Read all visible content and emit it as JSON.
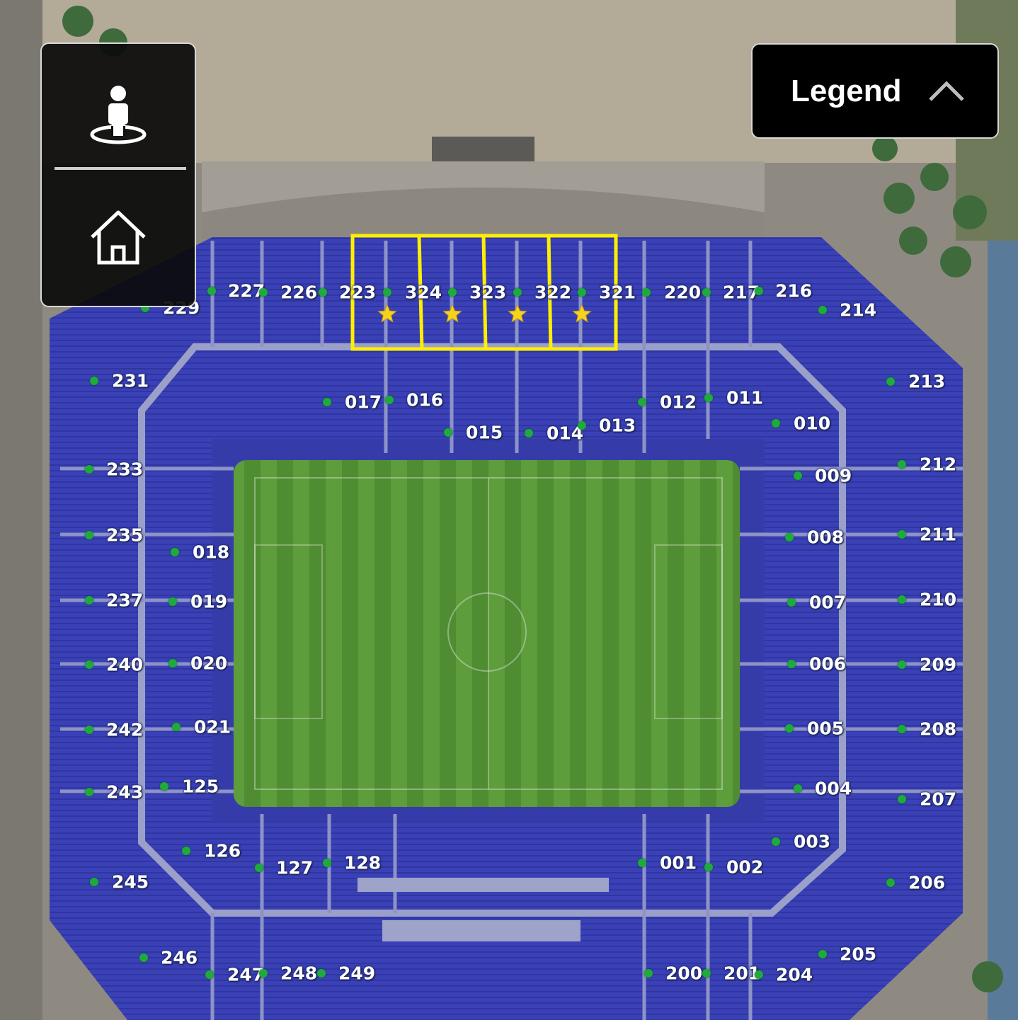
{
  "legend": {
    "label": "Legend",
    "icon": "chevron-up-icon"
  },
  "controls": {
    "view_icon": "person-pin-icon",
    "home_icon": "home-icon"
  },
  "colors": {
    "seating": "#3a40b5",
    "pitch": "#5a9a3a",
    "highlight": "#ffee00",
    "dot": "#1faa3d",
    "star": "#f7d21c"
  },
  "highlighted_sections": [
    "324",
    "323",
    "322",
    "321"
  ],
  "sections": {
    "s229": "229",
    "s227": "227",
    "s226": "226",
    "s223": "223",
    "s324": "324",
    "s323": "323",
    "s322": "322",
    "s321": "321",
    "s220": "220",
    "s217": "217",
    "s216": "216",
    "s214": "214",
    "s231": "231",
    "s017": "017",
    "s016": "016",
    "s015": "015",
    "s014": "014",
    "s013": "013",
    "s012": "012",
    "s011": "011",
    "s010": "010",
    "s213": "213",
    "s233": "233",
    "s009": "009",
    "s212": "212",
    "s235": "235",
    "s018": "018",
    "s008": "008",
    "s211": "211",
    "s237": "237",
    "s019": "019",
    "s007": "007",
    "s210": "210",
    "s240": "240",
    "s020": "020",
    "s006": "006",
    "s209": "209",
    "s242": "242",
    "s021": "021",
    "s005": "005",
    "s208": "208",
    "s243": "243",
    "s125": "125",
    "s004": "004",
    "s207": "207",
    "s126": "126",
    "s003": "003",
    "s245": "245",
    "s127": "127",
    "s128": "128",
    "s001": "001",
    "s002": "002",
    "s206": "206",
    "s246": "246",
    "s205": "205",
    "s247": "247",
    "s248": "248",
    "s249": "249",
    "s200": "200",
    "s201": "201",
    "s204": "204"
  }
}
